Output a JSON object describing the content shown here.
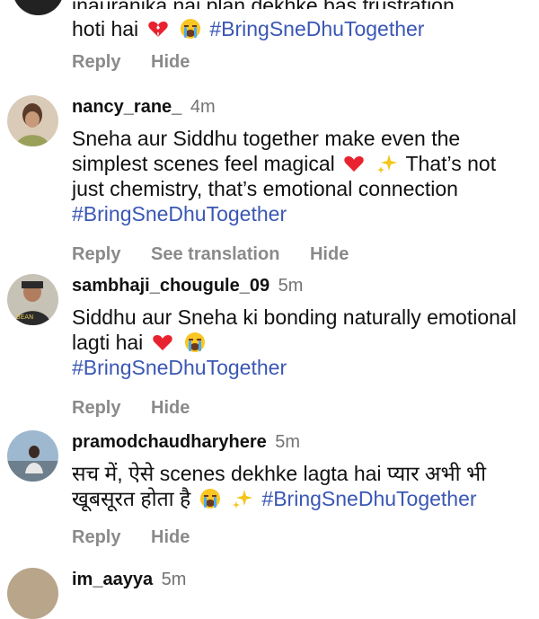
{
  "comments": [
    {
      "username": "",
      "time": "",
      "partial_top": "inauranika nai plan dekhke bas frustration",
      "line2_text": "hoti hai",
      "hashtag": "#BringSneDhuTogether",
      "actions": [
        "Reply",
        "Hide"
      ]
    },
    {
      "username": "nancy_rane_",
      "time": "4m",
      "text_1": "Sneha aur Siddhu together make even the simplest scenes feel magical",
      "text_2": "That’s not just chemistry, that’s emotional connection",
      "hashtag": "#BringSneDhuTogether",
      "actions": [
        "Reply",
        "See translation",
        "Hide"
      ]
    },
    {
      "username": "sambhaji_chougule_09",
      "time": "5m",
      "text_1": "Siddhu aur Sneha ki bonding naturally emotional lagti hai",
      "hashtag": "#BringSneDhuTogether",
      "actions": [
        "Reply",
        "Hide"
      ]
    },
    {
      "username": "pramodchaudharyhere",
      "time": "5m",
      "text_1": "सच में, ऐसे scenes dekhke lagta hai प्यार अभी भी खूबसूरत होता है",
      "hashtag": "#BringSneDhuTogether",
      "actions": [
        "Reply",
        "Hide"
      ]
    },
    {
      "username": "im_aayya",
      "time": "5m"
    }
  ],
  "colors": {
    "hashtag": "#3a57b4",
    "muted": "#8a8a8a",
    "heart": "#e8222e"
  }
}
